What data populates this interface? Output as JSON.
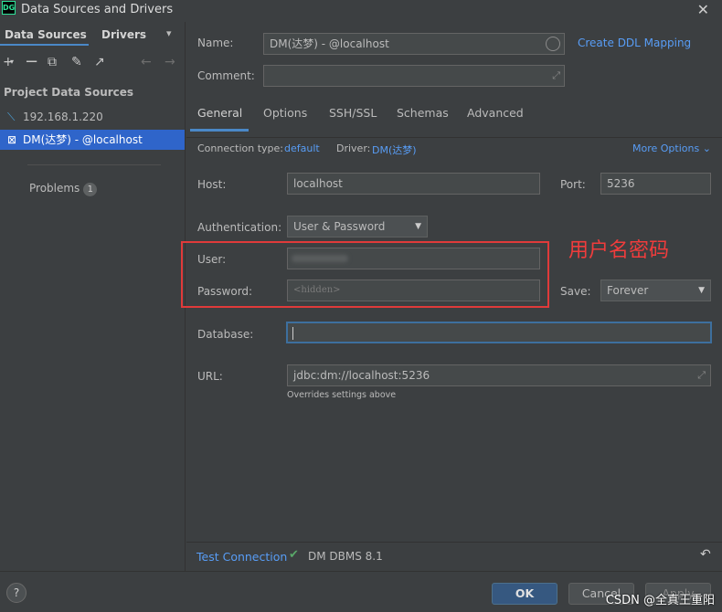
{
  "window": {
    "logo": "DG",
    "title": "Data Sources and Drivers",
    "close": "✕"
  },
  "left": {
    "tabs": {
      "sources": "Data Sources",
      "drivers": "Drivers"
    },
    "section_title": "Project Data Sources",
    "items": [
      {
        "label": "192.168.1.220",
        "icon": "database-icon"
      },
      {
        "label": "DM(达梦) - @localhost",
        "icon": "dm-database-icon"
      }
    ],
    "problems": {
      "label": "Problems",
      "count": "1"
    }
  },
  "form": {
    "name_label": "Name:",
    "name_value": "DM(达梦) - @localhost",
    "create_ddl": "Create DDL Mapping",
    "comment_label": "Comment:",
    "comment_value": "",
    "tabs": [
      "General",
      "Options",
      "SSH/SSL",
      "Schemas",
      "Advanced"
    ],
    "conn_type_label": "Connection type:",
    "conn_type_value": "default",
    "driver_label": "Driver:",
    "driver_value": "DM(达梦)",
    "more_options": "More Options",
    "host_label": "Host:",
    "host_value": "localhost",
    "port_label": "Port:",
    "port_value": "5236",
    "auth_label": "Authentication:",
    "auth_value": "User & Password",
    "user_label": "User:",
    "user_value": "",
    "password_label": "Password:",
    "password_placeholder": "<hidden>",
    "save_label": "Save:",
    "save_value": "Forever",
    "database_label": "Database:",
    "database_value": "",
    "url_label": "URL:",
    "url_value": "jdbc:dm://localhost:5236",
    "url_note": "Overrides settings above"
  },
  "annotation": "用户名密码",
  "status": {
    "test_connection": "Test Connection",
    "dbms": "DM DBMS 8.1"
  },
  "footer": {
    "help": "?",
    "ok": "OK",
    "cancel": "Cancel",
    "apply": "Apply"
  },
  "watermark": "CSDN @全真王重阳",
  "colors": {
    "accent": "#4a88c7",
    "link": "#589df6",
    "selection": "#2f65ca",
    "annotation": "#e03a3a",
    "success": "#59a869"
  }
}
